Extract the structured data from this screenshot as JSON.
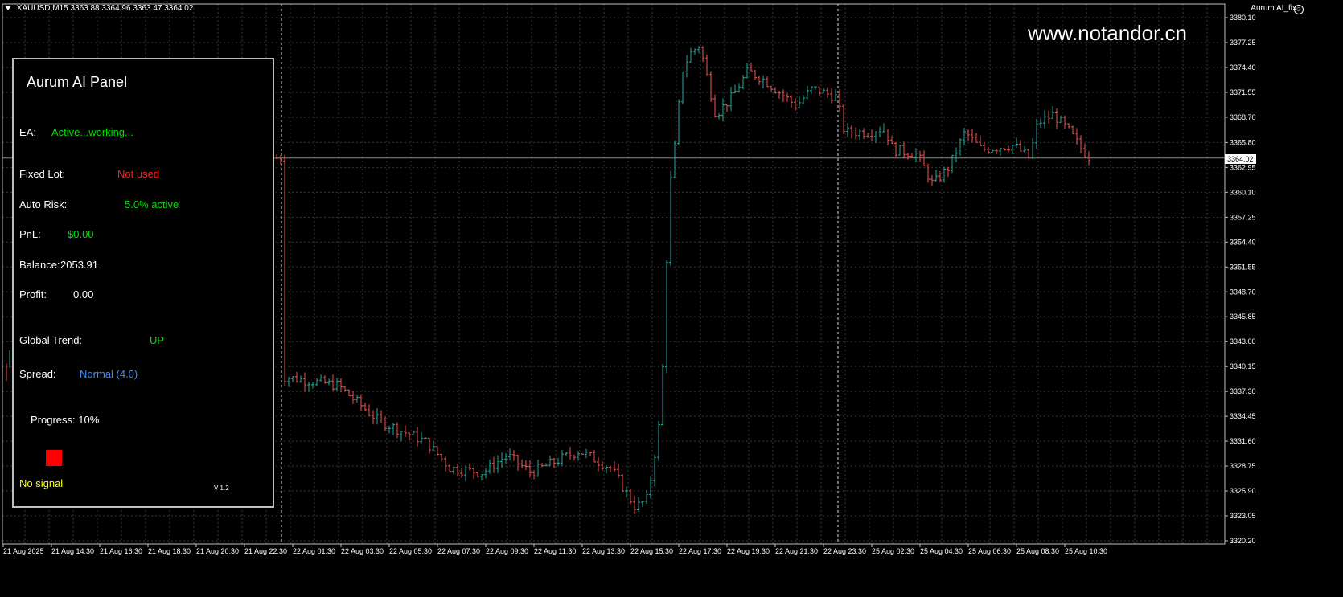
{
  "header": {
    "symbol_info": "XAUUSD,M15  3363.88 3364.96 3363.47 3364.02",
    "ea_name": "Aurum AI_fix",
    "smiley_icon": "smiley-icon"
  },
  "watermark": "www.notandor.cn",
  "current_price": "3364.02",
  "price_axis": [
    "3380.10",
    "3377.25",
    "3374.40",
    "3371.55",
    "3368.70",
    "3365.80",
    "3362.95",
    "3360.10",
    "3357.25",
    "3354.40",
    "3351.55",
    "3348.70",
    "3345.85",
    "3343.00",
    "3340.15",
    "3337.30",
    "3334.45",
    "3331.60",
    "3328.75",
    "3325.90",
    "3323.05",
    "3320.20"
  ],
  "time_axis": [
    "21 Aug 2025",
    "21 Aug 14:30",
    "21 Aug 16:30",
    "21 Aug 18:30",
    "21 Aug 20:30",
    "21 Aug 22:30",
    "22 Aug 01:30",
    "22 Aug 03:30",
    "22 Aug 05:30",
    "22 Aug 07:30",
    "22 Aug 09:30",
    "22 Aug 11:30",
    "22 Aug 13:30",
    "22 Aug 15:30",
    "22 Aug 17:30",
    "22 Aug 19:30",
    "22 Aug 21:30",
    "22 Aug 23:30",
    "25 Aug 02:30",
    "25 Aug 04:30",
    "25 Aug 06:30",
    "25 Aug 08:30",
    "25 Aug 10:30"
  ],
  "colors": {
    "bull": "#26a69a",
    "bear": "#ef5350",
    "grid": "#3a3a3a",
    "green": "#00e000",
    "red": "#ff2020",
    "blue": "#3c8cff",
    "yellow": "#ffff00"
  },
  "panel": {
    "title": "Aurum AI Panel",
    "ea_label": "EA:",
    "ea_value": "Active...working...",
    "fixed_lot_label": "Fixed Lot:",
    "fixed_lot_value": "Not used",
    "auto_risk_label": "Auto Risk:",
    "auto_risk_value": "5.0% active",
    "pnl_label": "PnL:",
    "pnl_value": "$0.00",
    "balance_label": "Balance:",
    "balance_value": "2053.91",
    "profit_label": "Profit:",
    "profit_value": "0.00",
    "trend_label": "Global Trend:",
    "trend_value": "UP",
    "spread_label": "Spread:",
    "spread_value": "Normal (4.0)",
    "progress_text": "Progress: 10%",
    "progress": 0.1,
    "signal_text": "No signal",
    "version": "V 1.2"
  }
}
